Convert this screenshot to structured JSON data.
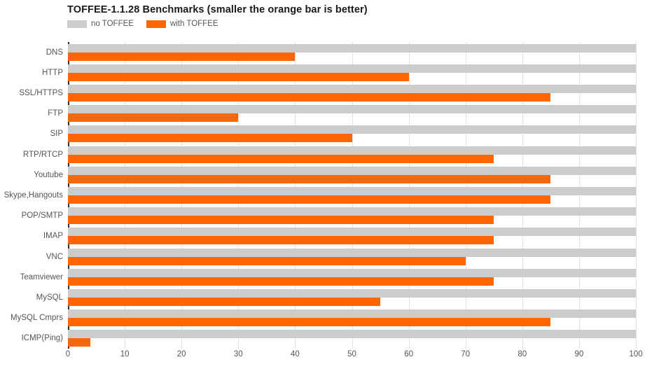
{
  "chart_data": {
    "type": "bar",
    "orientation": "horizontal",
    "title": "TOFFEE-1.1.28 Benchmarks (smaller the orange bar is better)",
    "xlabel": "",
    "ylabel": "",
    "xlim": [
      0,
      100
    ],
    "xticks": [
      0,
      10,
      20,
      30,
      40,
      50,
      60,
      70,
      80,
      90,
      100
    ],
    "xtick_labels": [
      "0",
      "10",
      "20",
      "30",
      "40",
      "50",
      "60",
      "70",
      "80",
      "90",
      "100"
    ],
    "grid": true,
    "grid_axis": "x",
    "legend_position": "top-left",
    "categories": [
      "DNS",
      "HTTP",
      "SSL/HTTPS",
      "FTP",
      "SIP",
      "RTP/RTCP",
      "Youtube",
      "Skype,Hangouts",
      "POP/SMTP",
      "IMAP",
      "VNC",
      "Teamviewer",
      "MySQL",
      "MySQL Cmprs",
      "ICMP(Ping)"
    ],
    "series": [
      {
        "name": "no TOFFEE",
        "color": "#cccccc",
        "values": [
          100,
          100,
          100,
          100,
          100,
          100,
          100,
          100,
          100,
          100,
          100,
          100,
          100,
          100,
          100
        ]
      },
      {
        "name": "with TOFFEE",
        "color": "#ff6600",
        "values": [
          40,
          60,
          85,
          30,
          50,
          75,
          85,
          85,
          75,
          75,
          70,
          75,
          55,
          85,
          4
        ]
      }
    ]
  },
  "colors": {
    "no_toffee": "#cccccc",
    "with_toffee": "#ff6600",
    "axis": "#333333",
    "grid": "#e2e2e2",
    "tick_text": "#555555",
    "title_text": "#1a1a1a",
    "background": "#ffffff"
  }
}
